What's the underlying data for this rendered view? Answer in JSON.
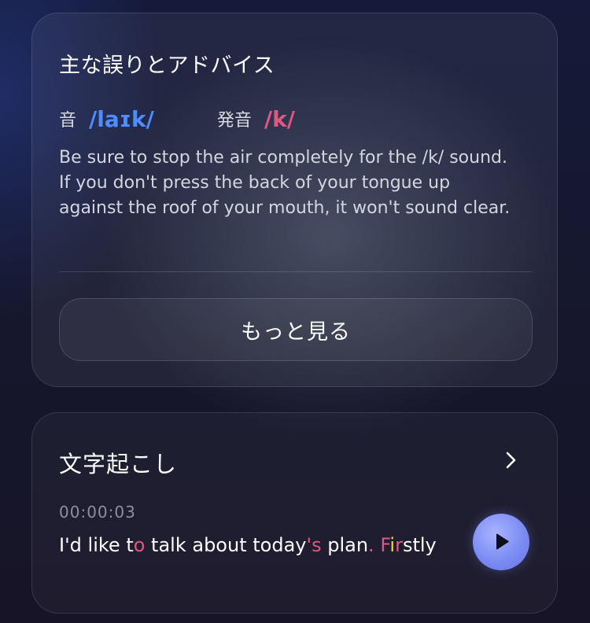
{
  "advice": {
    "title": "主な誤りとアドバイス",
    "sound_label": "音",
    "sound_value": "/laɪk/",
    "pronounced_label": "発音",
    "pronounced_value": "/k/",
    "body": "Be sure to stop the air completely for the /k/ sound. If you don't press the back of your tongue up against the roof of your mouth, it won't sound clear.",
    "more_label": "もっと見る"
  },
  "transcript": {
    "title": "文字起こし",
    "timestamp": "00:00:03",
    "segments": [
      {
        "text": "I'd like t",
        "style": "normal"
      },
      {
        "text": "o",
        "style": "pink"
      },
      {
        "text": " talk about today",
        "style": "normal"
      },
      {
        "text": "'s",
        "style": "pink"
      },
      {
        "text": " plan",
        "style": "normal"
      },
      {
        "text": ".",
        "style": "pink"
      },
      {
        "text": " ",
        "style": "normal"
      },
      {
        "text": "F",
        "style": "pink"
      },
      {
        "text": "i",
        "style": "yellow"
      },
      {
        "text": "r",
        "style": "pink"
      },
      {
        "text": "stly",
        "style": "normal"
      }
    ],
    "icons": {
      "chevron": "chevron-right-icon",
      "play": "play-icon"
    }
  },
  "colors": {
    "correct_phoneme": "#4f8cff",
    "error_pink": "#e0577f",
    "error_yellow": "#f2cf4f",
    "play_button": "#7b8cf3"
  }
}
